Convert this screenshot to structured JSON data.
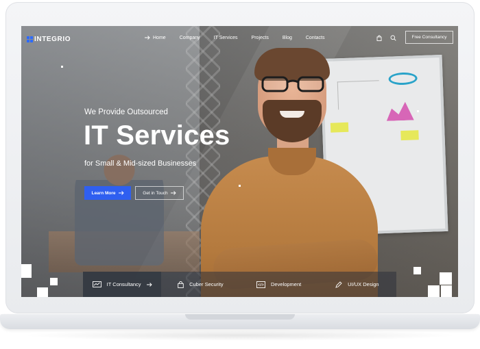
{
  "brand": {
    "name": "INTEGRIO"
  },
  "nav": {
    "items": [
      {
        "label": "Home",
        "icon": "arrow-right-icon"
      },
      {
        "label": "Company"
      },
      {
        "label": "IT Services"
      },
      {
        "label": "Projects"
      },
      {
        "label": "Blog"
      },
      {
        "label": "Contacts"
      }
    ],
    "cta": "Free Consultancy",
    "icons": [
      "bag-icon",
      "search-icon"
    ]
  },
  "hero": {
    "eyebrow": "We Provide Outsourced",
    "title": "IT Services",
    "subtitle": "for Small & Mid-sized Businesses",
    "primary_button": "Learn More",
    "secondary_button": "Get in Touch"
  },
  "services": [
    {
      "label": "IT Consultancy",
      "icon": "chart-monitor-icon",
      "active": true
    },
    {
      "label": "Cuber Security",
      "icon": "lock-icon"
    },
    {
      "label": "Development",
      "icon": "code-icon"
    },
    {
      "label": "UI/UX Design",
      "icon": "pen-icon"
    }
  ],
  "colors": {
    "accent": "#2f5ff0",
    "shirt": "#c68b4e"
  }
}
